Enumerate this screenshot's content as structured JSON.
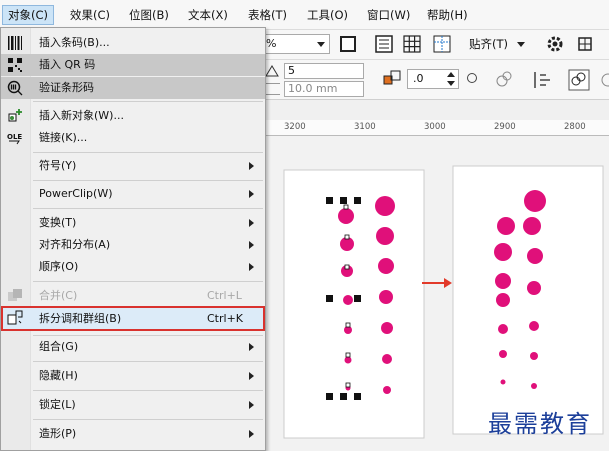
{
  "menubar": {
    "items": [
      "对象(C)",
      "效果(C)",
      "位图(B)",
      "文本(X)",
      "表格(T)",
      "工具(O)",
      "窗口(W)",
      "帮助(H)"
    ]
  },
  "toolbar": {
    "zoom_suffix": "%",
    "snap_label": "贴齐(T)",
    "width_value": "5",
    "outline_value": "10.0 mm",
    "rotation_value": ".0"
  },
  "ruler": {
    "labels": [
      "3200",
      "3100",
      "3000",
      "2900",
      "2800"
    ]
  },
  "menu": {
    "items": [
      {
        "label": "插入条码(B)...",
        "shortcut": "",
        "icon": "barcode-icon"
      },
      {
        "label": "插入 QR 码",
        "shortcut": "",
        "icon": "qr-code-icon"
      },
      {
        "label": "验证条形码",
        "shortcut": "",
        "icon": "verify-barcode-icon"
      },
      {
        "label": "插入新对象(W)...",
        "shortcut": "",
        "icon": "insert-object-icon"
      },
      {
        "label": "链接(K)...",
        "shortcut": "",
        "icon": "ole-link-icon"
      },
      {
        "label": "符号(Y)",
        "shortcut": "",
        "icon": ""
      },
      {
        "label": "PowerClip(W)",
        "shortcut": "",
        "icon": ""
      },
      {
        "label": "变换(T)",
        "shortcut": "",
        "icon": ""
      },
      {
        "label": "对齐和分布(A)",
        "shortcut": "",
        "icon": ""
      },
      {
        "label": "顺序(O)",
        "shortcut": "",
        "icon": ""
      },
      {
        "label": "合并(C)",
        "shortcut": "Ctrl+L",
        "icon": "combine-icon"
      },
      {
        "label": "拆分调和群组(B)",
        "shortcut": "Ctrl+K",
        "icon": "break-apart-icon"
      },
      {
        "label": "组合(G)",
        "shortcut": "",
        "icon": ""
      },
      {
        "label": "隐藏(H)",
        "shortcut": "",
        "icon": ""
      },
      {
        "label": "锁定(L)",
        "shortcut": "",
        "icon": ""
      },
      {
        "label": "造形(P)",
        "shortcut": "",
        "icon": ""
      }
    ]
  },
  "watermark": "最需教育",
  "colors": {
    "accent": "#e0107a",
    "highlight": "#d9322e",
    "watermark": "#1c3f9a"
  }
}
